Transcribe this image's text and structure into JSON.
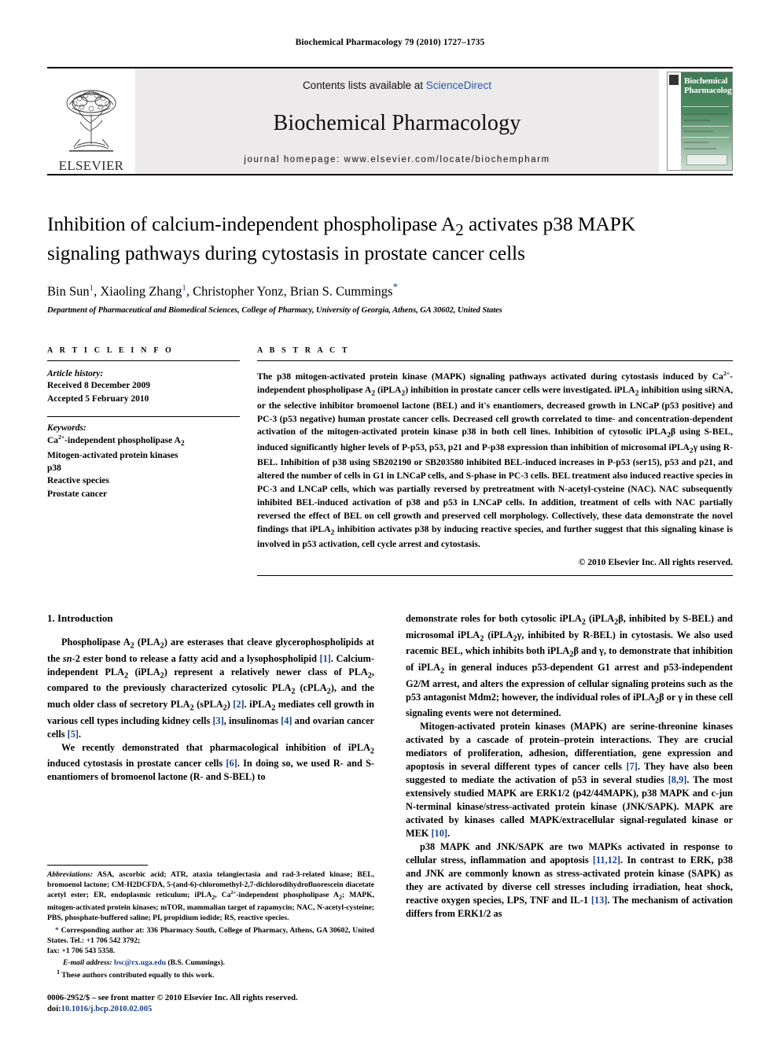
{
  "running_head": "Biochemical Pharmacology 79 (2010) 1727–1735",
  "masthead": {
    "contents_prefix": "Contents lists available at ",
    "sciencedirect": "ScienceDirect",
    "journal_title": "Biochemical Pharmacology",
    "homepage": "journal homepage: www.elsevier.com/locate/biochempharm",
    "publisher_name": "ELSEVIER",
    "cover_title_line1": "Biochemical",
    "cover_title_line2": "Pharmacology"
  },
  "article": {
    "title_line1": "Inhibition of calcium-independent phospholipase A",
    "title_sub1": "2",
    "title_line1b": " activates p38 MAPK",
    "title_line2": "signaling pathways during cytostasis in prostate cancer cells",
    "authors_1": "Bin Sun",
    "authors_2": "Xiaoling Zhang",
    "authors_3": "Christopher Yonz",
    "authors_4": "Brian S. Cummings",
    "affiliation": "Department of Pharmaceutical and Biomedical Sciences, College of Pharmacy, University of Georgia, Athens, GA 30602, United States"
  },
  "article_info": {
    "label": "A R T I C L E  I N F O",
    "history_head": "Article history:",
    "received": "Received 8 December 2009",
    "accepted": "Accepted 5 February 2010",
    "keywords_head": "Keywords:",
    "keywords": [
      "Ca2+-independent phospholipase A2",
      "Mitogen-activated protein kinases",
      "p38",
      "Reactive species",
      "Prostate cancer"
    ]
  },
  "abstract": {
    "label": "A B S T R A C T",
    "text": "The p38 mitogen-activated protein kinase (MAPK) signaling pathways activated during cytostasis induced by Ca2+-independent phospholipase A2 (iPLA2) inhibition in prostate cancer cells were investigated. iPLA2 inhibition using siRNA, or the selective inhibitor bromoenol lactone (BEL) and it's enantiomers, decreased growth in LNCaP (p53 positive) and PC-3 (p53 negative) human prostate cancer cells. Decreased cell growth correlated to time- and concentration-dependent activation of the mitogen-activated protein kinase p38 in both cell lines. Inhibition of cytosolic iPLA2β using S-BEL, induced significantly higher levels of P-p53, p53, p21 and P-p38 expression than inhibition of microsomal iPLA2γ using R-BEL. Inhibition of p38 using SB202190 or SB203580 inhibited BEL-induced increases in P-p53 (ser15), p53 and p21, and altered the number of cells in G1 in LNCaP cells, and S-phase in PC-3 cells. BEL treatment also induced reactive species in PC-3 and LNCaP cells, which was partially reversed by pretreatment with N-acetyl-cysteine (NAC). NAC subsequently inhibited BEL-induced activation of p38 and p53 in LNCaP cells. In addition, treatment of cells with NAC partially reversed the effect of BEL on cell growth and preserved cell morphology. Collectively, these data demonstrate the novel findings that iPLA2 inhibition activates p38 by inducing reactive species, and further suggest that this signaling kinase is involved in p53 activation, cell cycle arrest and cytostasis.",
    "copyright": "© 2010 Elsevier Inc. All rights reserved."
  },
  "intro": {
    "heading": "1. Introduction",
    "p1": "Phospholipase A2 (PLA2) are esterases that cleave glycerophospholipids at the sn-2 ester bond to release a fatty acid and a lysophospholipid [1]. Calcium-independent PLA2 (iPLA2) represent a relatively newer class of PLA2, compared to the previously characterized cytosolic PLA2 (cPLA2), and the much older class of secretory PLA2 (sPLA2) [2]. iPLA2 mediates cell growth in various cell types including kidney cells [3], insulinomas [4] and ovarian cancer cells [5].",
    "p2": "We recently demonstrated that pharmacological inhibition of iPLA2 induced cytostasis in prostate cancer cells [6]. In doing so, we used R- and S-enantiomers of bromoenol lactone (R- and S-BEL) to",
    "p3": "demonstrate roles for both cytosolic iPLA2 (iPLA2β, inhibited by S-BEL) and microsomal iPLA2 (iPLA2γ, inhibited by R-BEL) in cytostasis. We also used racemic BEL, which inhibits both iPLA2β and γ, to demonstrate that inhibition of iPLA2 in general induces p53-dependent G1 arrest and p53-independent G2/M arrest, and alters the expression of cellular signaling proteins such as the p53 antagonist Mdm2; however, the individual roles of iPLA2β or γ in these cell signaling events were not determined.",
    "p4": "Mitogen-activated protein kinases (MAPK) are serine-threonine kinases activated by a cascade of protein–protein interactions. They are crucial mediators of proliferation, adhesion, differentiation, gene expression and apoptosis in several different types of cancer cells [7]. They have also been suggested to mediate the activation of p53 in several studies [8,9]. The most extensively studied MAPK are ERK1/2 (p42/44MAPK), p38 MAPK and c-jun N-terminal kinase/stress-activated protein kinase (JNK/SAPK). MAPK are activated by kinases called MAPK/extracellular signal-regulated kinase or MEK [10].",
    "p5": "p38 MAPK and JNK/SAPK are two MAPKs activated in response to cellular stress, inflammation and apoptosis [11,12]. In contrast to ERK, p38 and JNK are commonly known as stress-activated protein kinase (SAPK) as they are activated by diverse cell stresses including irradiation, heat shock, reactive oxygen species, LPS, TNF and IL-1 [13]. The mechanism of activation differs from ERK1/2 as"
  },
  "footnotes": {
    "abbrev_label": "Abbreviations:",
    "abbrev_text": " ASA, ascorbic acid; ATR, ataxia telangiectasia and rad-3-related kinase; BEL, bromoenol lactone; CM-H2DCFDA, 5-(and-6)-chloromethyl-2,7-dichlorodihydrofluorescein diacetate acetyl ester; ER, endoplasmic reticulum; iPLA2, Ca2+-independent phospholipase A2; MAPK, mitogen-activated protein kinases; mTOR, mammalian target of rapamycin; NAC, N-acetyl-cysteine; PBS, phosphate-buffered saline; PI, propidium iodide; RS, reactive species.",
    "corresponding": "Corresponding author at: 336 Pharmacy South, College of Pharmacy, Athens, GA 30602, United States. Tel.: +1 706 542 3792;",
    "fax": "fax: +1 706 543 5358.",
    "email_label": "E-mail address:",
    "email": "bsc@rx.uga.edu",
    "email_owner": " (B.S. Cummings).",
    "equal_contrib_marker": "1",
    "equal_contrib": "These authors contributed equally to this work.",
    "issn_line": "0006-2952/$ – see front matter © 2010 Elsevier Inc. All rights reserved.",
    "doi_label": "doi:",
    "doi": "10.1016/j.bcp.2010.02.005"
  }
}
